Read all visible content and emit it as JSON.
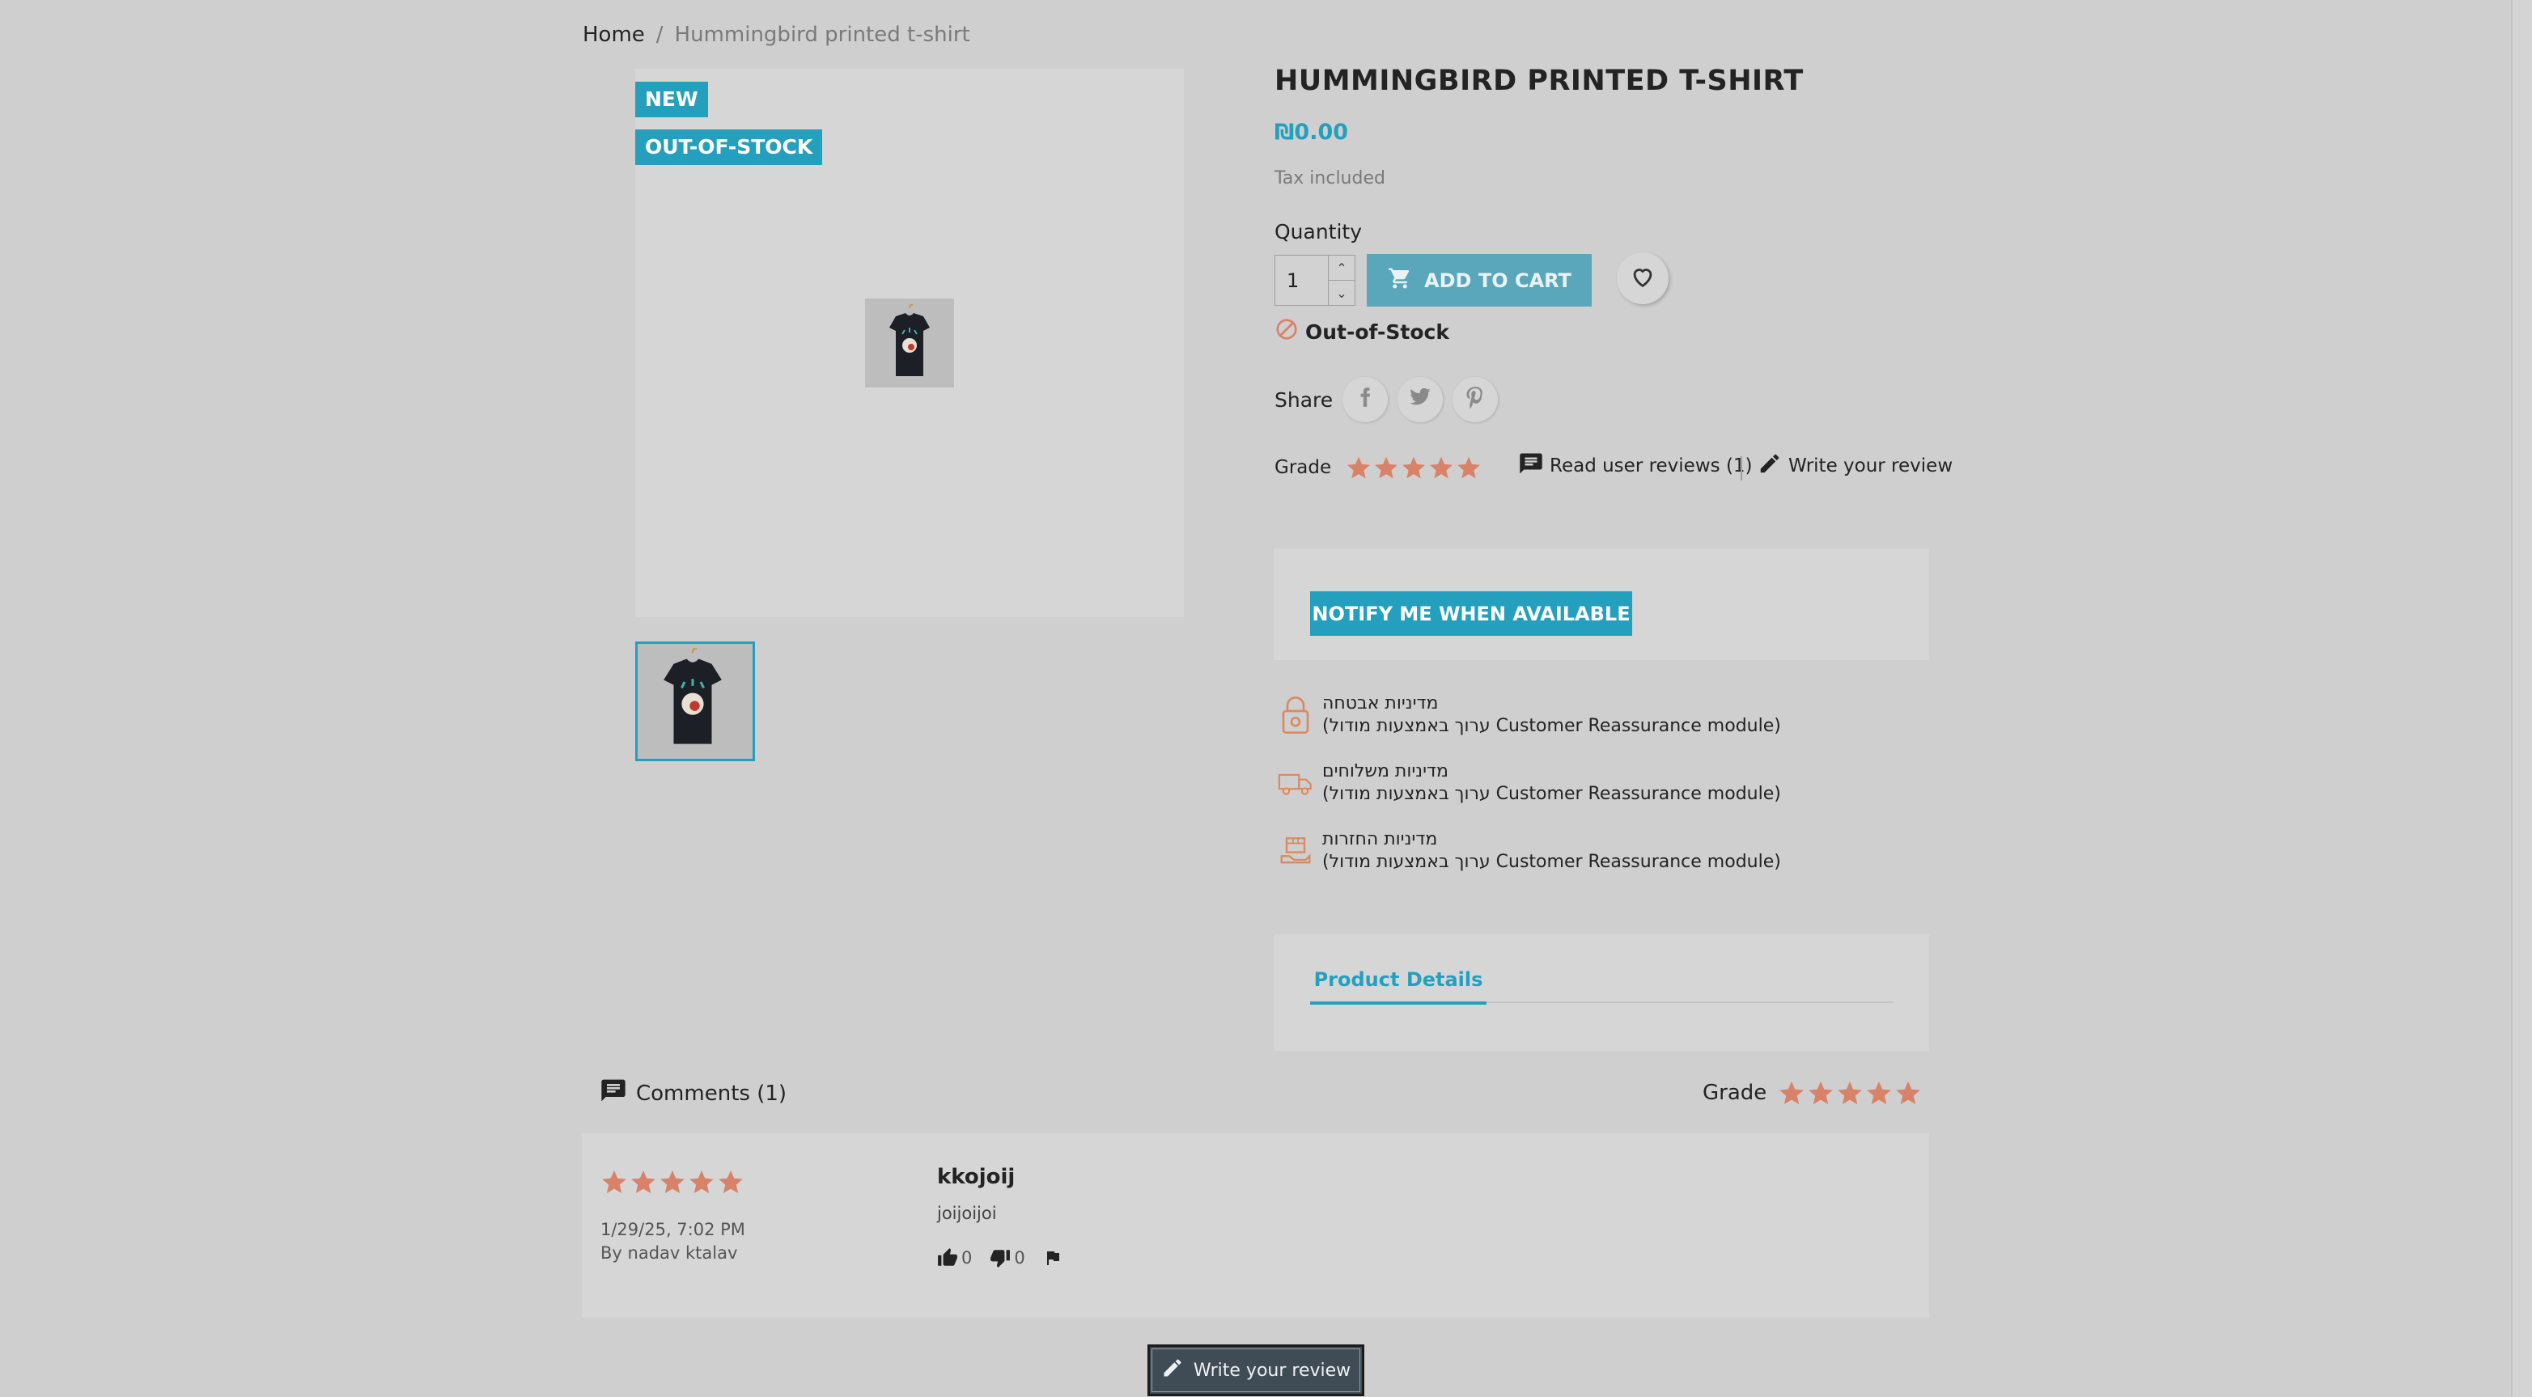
{
  "breadcrumb": {
    "home": "Home",
    "separator": "/",
    "current": "Hummingbird printed t-shirt"
  },
  "flags": {
    "new": "NEW",
    "out_of_stock": "OUT-OF-STOCK"
  },
  "product": {
    "title": "HUMMINGBIRD PRINTED T-SHIRT",
    "price": "₪0.00",
    "tax_note": "Tax included",
    "quantity_label": "Quantity",
    "quantity_value": "1",
    "add_to_cart": "ADD TO CART",
    "availability": "Out-of-Stock",
    "share_label": "Share",
    "grade_label": "Grade",
    "rating_stars": 5,
    "read_reviews": "Read user reviews (1)",
    "write_review": "Write your review",
    "notify": "NOTIFY ME WHEN AVAILABLE"
  },
  "reassurance": [
    {
      "icon": "lock-icon",
      "title": "מדיניות אבטחה",
      "text": "(ערוך באמצעות מודול Customer Reassurance module)"
    },
    {
      "icon": "truck-icon",
      "title": "מדיניות משלוחים",
      "text": "(ערוך באמצעות מודול Customer Reassurance module)"
    },
    {
      "icon": "return-box-icon",
      "title": "מדיניות החזרות",
      "text": "(ערוך באמצעות מודול Customer Reassurance module)"
    }
  ],
  "tabs": {
    "details": "Product Details"
  },
  "comments": {
    "header": "Comments (1)",
    "grade_label": "Grade",
    "review": {
      "stars": 5,
      "date": "1/29/25, 7:02 PM",
      "author": "By nadav ktalav",
      "title": "kkojoij",
      "body": "joijoijoi",
      "useful": "0",
      "not_useful": "0"
    },
    "write_button": "Write your review"
  },
  "colors": {
    "accent": "#24a0be",
    "star": "#d9826a",
    "icon_orange": "#d98a62",
    "page_bg": "#cfcfcf"
  }
}
